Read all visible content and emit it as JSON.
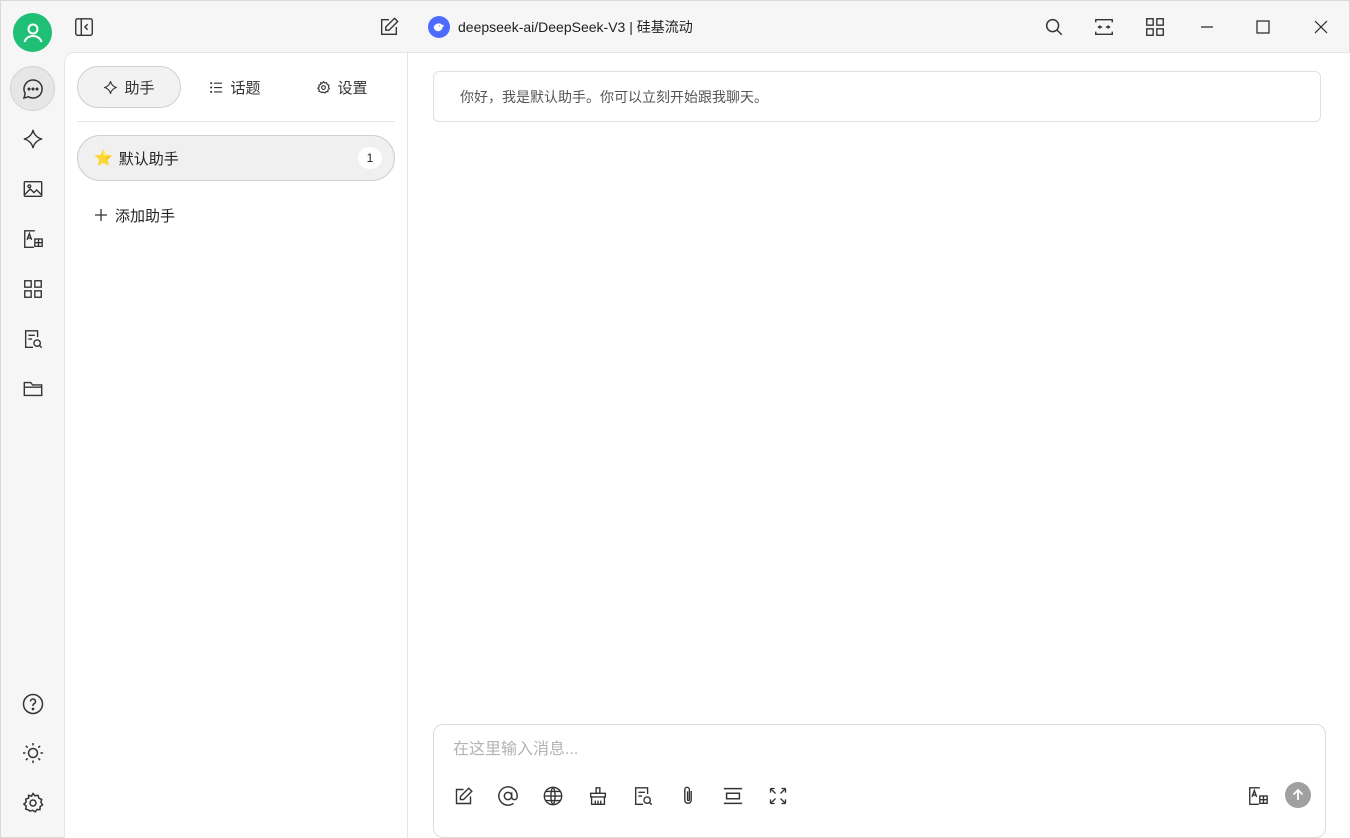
{
  "app": {
    "model_title": "deepseek-ai/DeepSeek-V3 | 硅基流动",
    "accent_color": "#1fbf75",
    "model_logo_color": "#4d6bfe"
  },
  "rail": {
    "top_items": [
      "chat-icon",
      "sparkle-icon",
      "image-icon",
      "translate-icon",
      "apps-icon",
      "knowledge-icon",
      "folder-icon"
    ],
    "bottom_items": [
      "help-icon",
      "theme-icon",
      "settings-icon"
    ]
  },
  "sidebar": {
    "tabs": [
      {
        "label": "助手",
        "icon": "sparkle-icon",
        "active": true
      },
      {
        "label": "话题",
        "icon": "list-icon",
        "active": false
      },
      {
        "label": "设置",
        "icon": "gear-icon",
        "active": false
      }
    ],
    "assistant": {
      "emoji": "⭐",
      "name": "默认助手",
      "count": "1"
    },
    "add_assistant": "添加助手"
  },
  "chat": {
    "greeting": "你好，我是默认助手。你可以立刻开始跟我聊天。",
    "input_placeholder": "在这里输入消息...",
    "tools": [
      "new-topic-icon",
      "mention-icon",
      "web-search-icon",
      "clear-icon",
      "knowledge-icon",
      "attachment-icon",
      "context-icon",
      "expand-icon"
    ]
  }
}
